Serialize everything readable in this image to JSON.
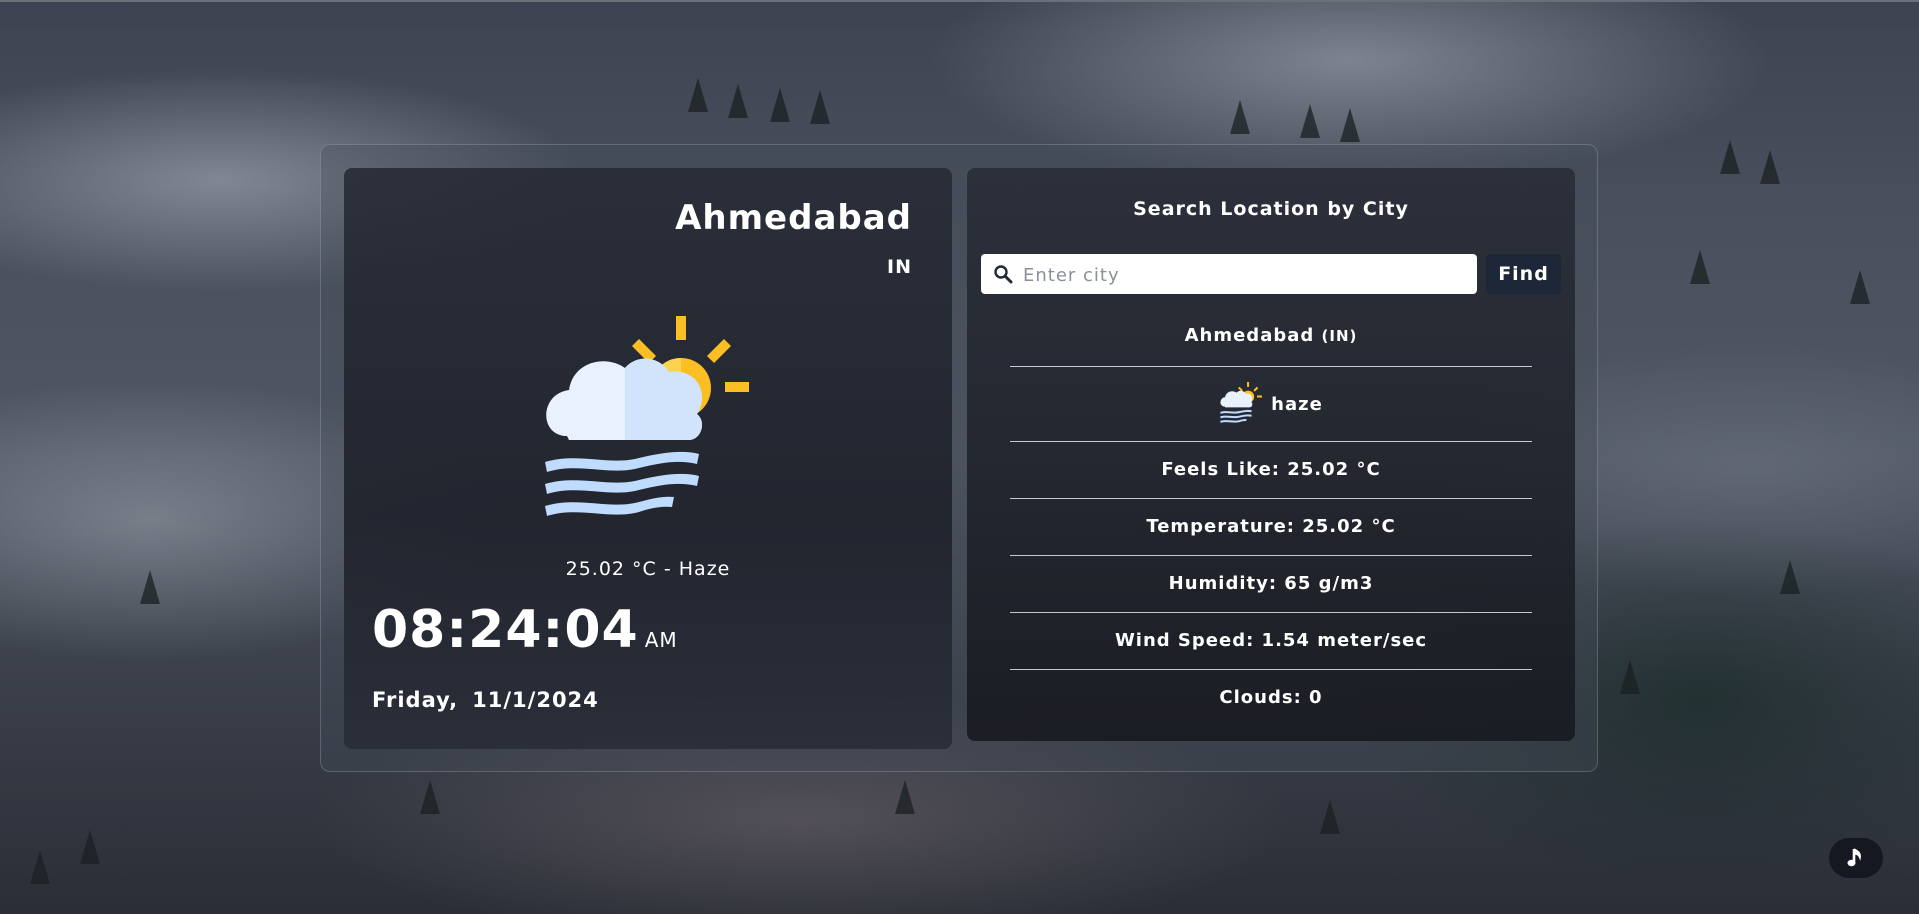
{
  "location": {
    "city": "Ahmedabad",
    "country": "IN"
  },
  "current": {
    "temp_desc": "25.02 °C - Haze",
    "time": "08:24:04",
    "ampm": "AM",
    "day": "Friday,",
    "date": "11/1/2024",
    "weather_icon": "cloud-sun-haze-icon"
  },
  "search": {
    "title": "Search Location by City",
    "placeholder": "Enter city",
    "value": "",
    "button_label": "Find"
  },
  "details": {
    "city": "Ahmedabad",
    "country_label": "(IN)",
    "condition": "haze",
    "feels_like": "Feels Like: 25.02 °C",
    "temperature": "Temperature: 25.02 °C",
    "humidity": "Humidity: 65 g/m3",
    "wind_speed": "Wind Speed: 1.54 meter/sec",
    "clouds": "Clouds: 0"
  },
  "colors": {
    "find_button": "#1e2738",
    "sun": "#fbbf24",
    "cloud": "#e8f1fd",
    "haze": "#bfdbfe"
  },
  "controls": {
    "music_icon": "music-note-icon"
  }
}
